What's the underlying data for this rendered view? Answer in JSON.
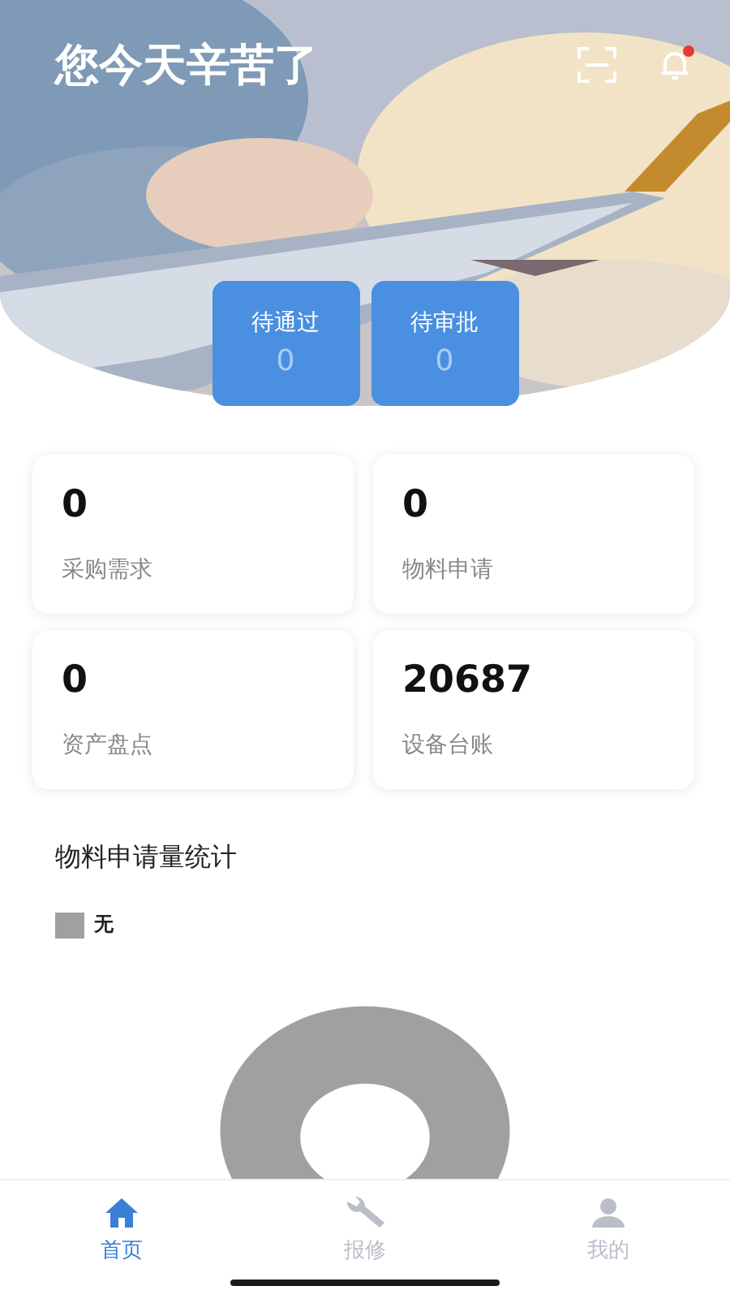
{
  "header": {
    "title": "您今天辛苦了",
    "notification_dot": true
  },
  "pending": [
    {
      "label": "待通过",
      "count": "0"
    },
    {
      "label": "待审批",
      "count": "0"
    }
  ],
  "stats": [
    {
      "value": "0",
      "label": "采购需求"
    },
    {
      "value": "0",
      "label": "物料申请"
    },
    {
      "value": "0",
      "label": "资产盘点"
    },
    {
      "value": "20687",
      "label": "设备台账"
    }
  ],
  "chart": {
    "title": "物料申请量统计",
    "legend": [
      {
        "label": "无",
        "color": "#a0a0a0"
      }
    ]
  },
  "tab_bar": [
    {
      "label": "首页",
      "kind": "home",
      "selected": true
    },
    {
      "label": "报修",
      "kind": "repair",
      "selected": false
    },
    {
      "label": "我的",
      "kind": "profile",
      "selected": false
    }
  ]
}
